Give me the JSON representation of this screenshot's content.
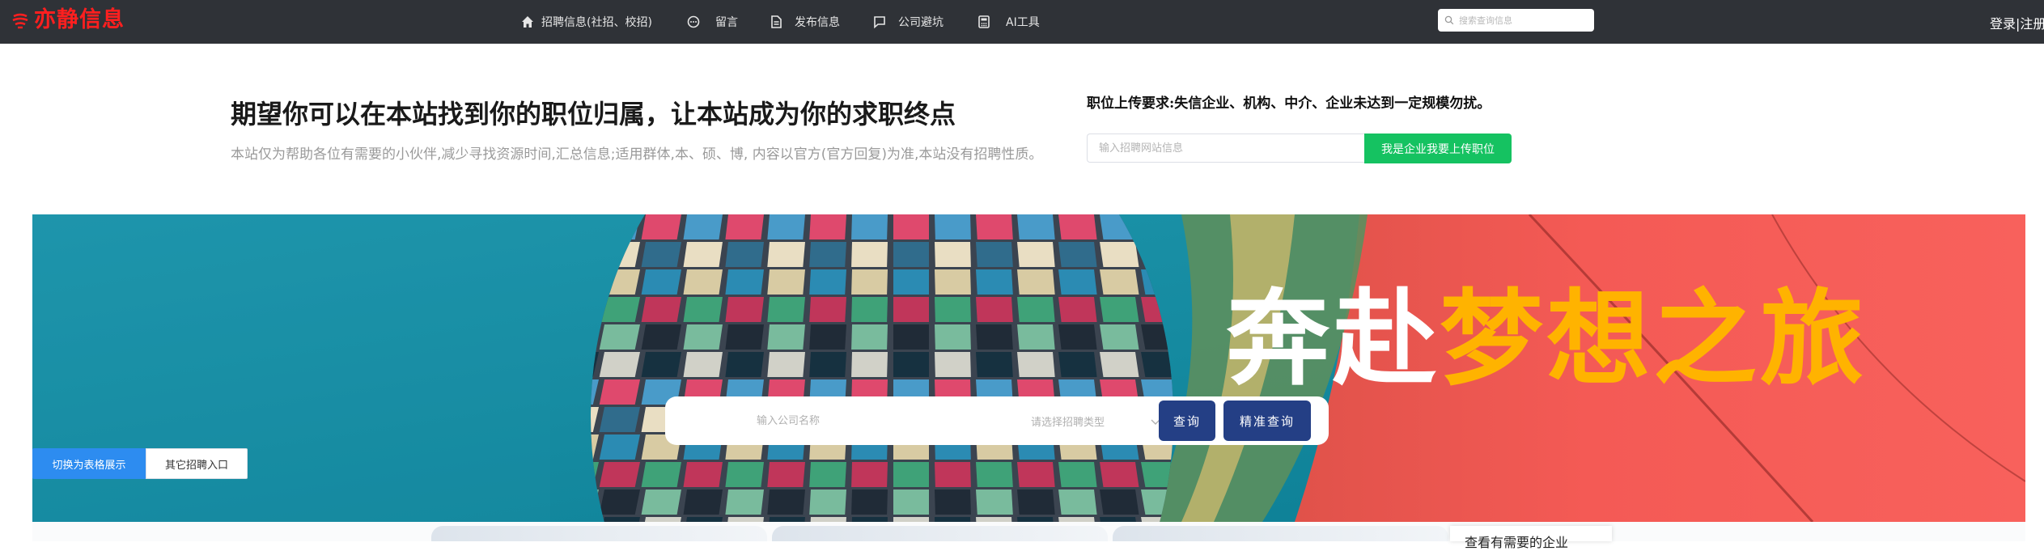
{
  "brand": {
    "name": "亦静信息",
    "color": "#ff1f1f"
  },
  "nav": {
    "items": [
      {
        "label": "招聘信息(社招、校招)",
        "icon": "home-icon"
      },
      {
        "label": "留言",
        "icon": "chat-bubble-icon"
      },
      {
        "label": "发布信息",
        "icon": "document-icon"
      },
      {
        "label": "公司避坑",
        "icon": "message-square-icon"
      },
      {
        "label": "AI工具",
        "icon": "calculator-icon"
      }
    ],
    "search_placeholder": "搜索查询信息",
    "login_label": "登录|注册"
  },
  "intro": {
    "headline": "期望你可以在本站找到你的职位归属，让本站成为你的求职终点",
    "subline": "本站仅为帮助各位有需要的小伙伴,减少寻找资源时间,汇总信息;适用群体,本、硕、博, 内容以官方(官方回复)为准,本站没有招聘性质。",
    "requirement": "职位上传要求:失信企业、机构、中介、企业未达到一定规模勿扰。",
    "site_placeholder": "输入招聘网站信息",
    "upload_label": "我是企业我要上传职位"
  },
  "banner": {
    "slogan_white": "奔赴",
    "slogan_yellow": "梦想之旅",
    "company_placeholder": "输入公司名称",
    "type_placeholder": "请选择招聘类型",
    "query_label": "查询",
    "precise_query_label": "精准查询",
    "toggle_label": "切换为表格展示",
    "other_label": "其它招聘入口"
  },
  "side": {
    "title": "查看有需要的企业"
  },
  "colors": {
    "topbar": "#2f3237",
    "accent_green": "#15c261",
    "accent_blue": "#2d8cf0",
    "query_navy": "#243f85",
    "slogan_yellow": "#ffb300"
  }
}
